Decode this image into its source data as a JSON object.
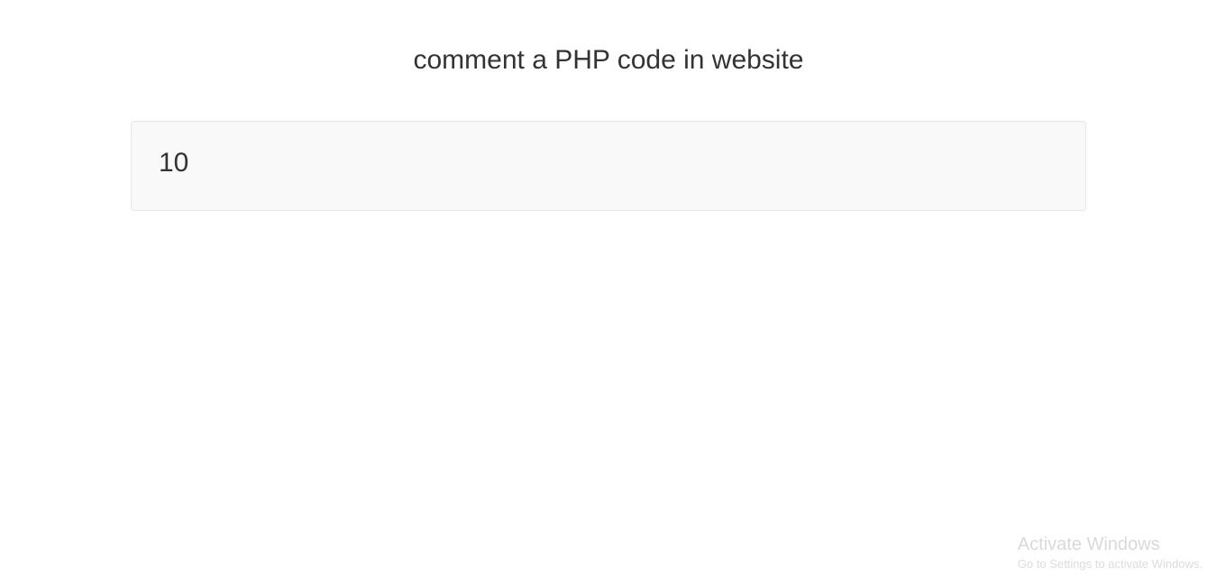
{
  "page": {
    "title": "comment a PHP code in website"
  },
  "well": {
    "value": "10"
  },
  "watermark": {
    "title": "Activate Windows",
    "subtitle": "Go to Settings to activate Windows."
  }
}
